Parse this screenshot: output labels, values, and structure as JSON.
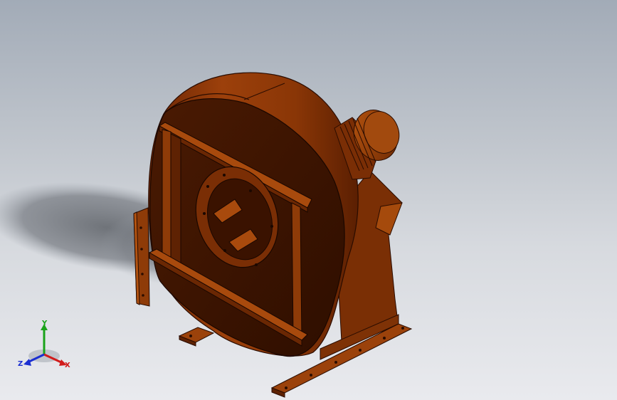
{
  "viewport": {
    "background_top": "#a2abb7",
    "background_bottom": "#e9eaee"
  },
  "model": {
    "part_color": "#9a3d0a",
    "dark_color": "#3b1300",
    "highlight_color": "#b2520f"
  },
  "triad": {
    "x_label": "X",
    "y_label": "Y",
    "z_label": "Z",
    "x_color": "#d11b1b",
    "y_color": "#1aa31a",
    "z_color": "#1b2fd1"
  }
}
